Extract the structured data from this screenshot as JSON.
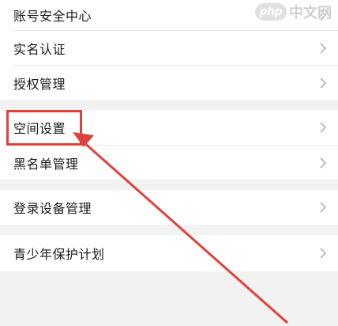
{
  "menu": {
    "items": [
      {
        "label": "账号安全中心"
      },
      {
        "label": "实名认证"
      },
      {
        "label": "授权管理"
      },
      {
        "label": "空间设置"
      },
      {
        "label": "黑名单管理"
      },
      {
        "label": "登录设备管理"
      },
      {
        "label": "青少年保护计划"
      }
    ]
  },
  "watermark": {
    "badge": "php",
    "text": "中文网"
  },
  "colors": {
    "annotation": "#e0403b",
    "background": "#f2f2f2",
    "row": "#ffffff",
    "chevron": "#b3b3b3"
  },
  "icons": {
    "row_action": "chevron-right-icon"
  }
}
